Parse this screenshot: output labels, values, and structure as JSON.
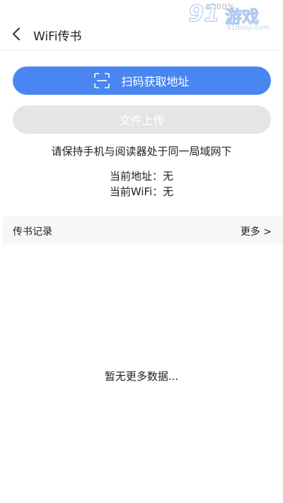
{
  "status": {
    "battery_text": "⊙100%"
  },
  "watermark": {
    "number": "91",
    "brand": "游戏",
    "url": "91danji.com"
  },
  "nav": {
    "back_icon": "chevron-left-icon",
    "title": "WiFi传书"
  },
  "actions": {
    "scan_icon": "scan-icon",
    "scan_label": "扫码获取地址",
    "upload_label": "文件上传"
  },
  "info": {
    "lan_hint": "请保持手机与阅读器处于同一局域网下",
    "address_line": "当前地址：无",
    "wifi_line": "当前WiFi：无"
  },
  "records": {
    "title": "传书记录",
    "more_label": "更多 >",
    "empty_text": "暂无更多数据..."
  },
  "colors": {
    "primary": "#4a86f1",
    "disabled_button": "#e5e5e5",
    "section_bg": "#f7f7f7",
    "text": "#222222"
  }
}
